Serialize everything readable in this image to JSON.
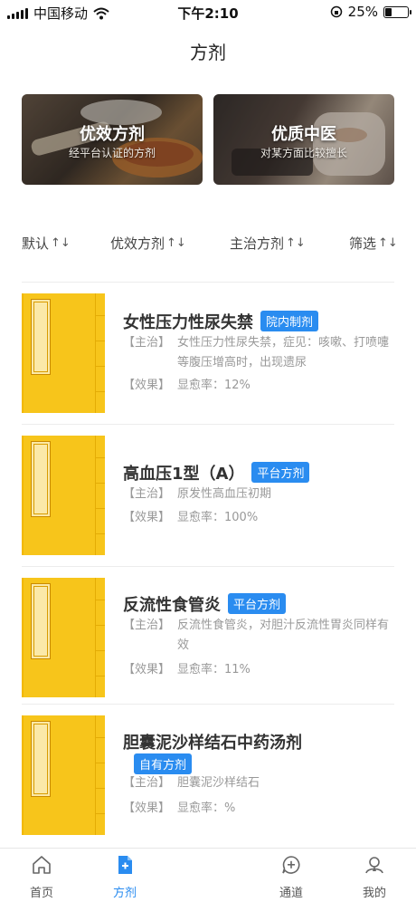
{
  "status": {
    "carrier": "中国移动",
    "time": "下午2:10",
    "battery_pct": "25%",
    "battery_level": 0.25
  },
  "header": {
    "title": "方剂"
  },
  "banners": [
    {
      "title": "优效方剂",
      "subtitle": "经平台认证的方剂"
    },
    {
      "title": "优质中医",
      "subtitle": "对某方面比较擅长"
    }
  ],
  "filters": [
    {
      "label": "默认",
      "sort": "↑↓"
    },
    {
      "label": "优效方剂",
      "sort": "↑↓"
    },
    {
      "label": "主治方剂",
      "sort": "↑↓"
    },
    {
      "label": "筛选",
      "sort": "↑↓"
    }
  ],
  "items": [
    {
      "name": "女性压力性尿失禁",
      "badge": "院内制剂",
      "indication_key": "【主治】",
      "indication": "女性压力性尿失禁，症见：咳嗽、打喷嚏等腹压增高时，出现遗尿",
      "effect_key": "【效果】",
      "effect": "显愈率：12%"
    },
    {
      "name": "高血压1型（A）",
      "badge": "平台方剂",
      "indication_key": "【主治】",
      "indication": "原发性高血压初期",
      "effect_key": "【效果】",
      "effect": "显愈率：100%"
    },
    {
      "name": "反流性食管炎",
      "badge": "平台方剂",
      "indication_key": "【主治】",
      "indication": "反流性食管炎，对胆汁反流性胃炎同样有效",
      "effect_key": "【效果】",
      "effect": "显愈率：11%"
    },
    {
      "name": "胆囊泥沙样结石中药汤剂",
      "badge": "自有方剂",
      "indication_key": "【主治】",
      "indication": "胆囊泥沙样结石",
      "effect_key": "【效果】",
      "effect": "显愈率：%"
    }
  ],
  "tabbar": [
    {
      "label": "首页",
      "icon": "home-icon"
    },
    {
      "label": "方剂",
      "icon": "prescription-icon",
      "active": true
    },
    {
      "label": "通道",
      "icon": "channel-icon"
    },
    {
      "label": "我的",
      "icon": "profile-icon"
    }
  ],
  "colors": {
    "accent": "#2a8cf0",
    "book": "#f7c51b"
  }
}
